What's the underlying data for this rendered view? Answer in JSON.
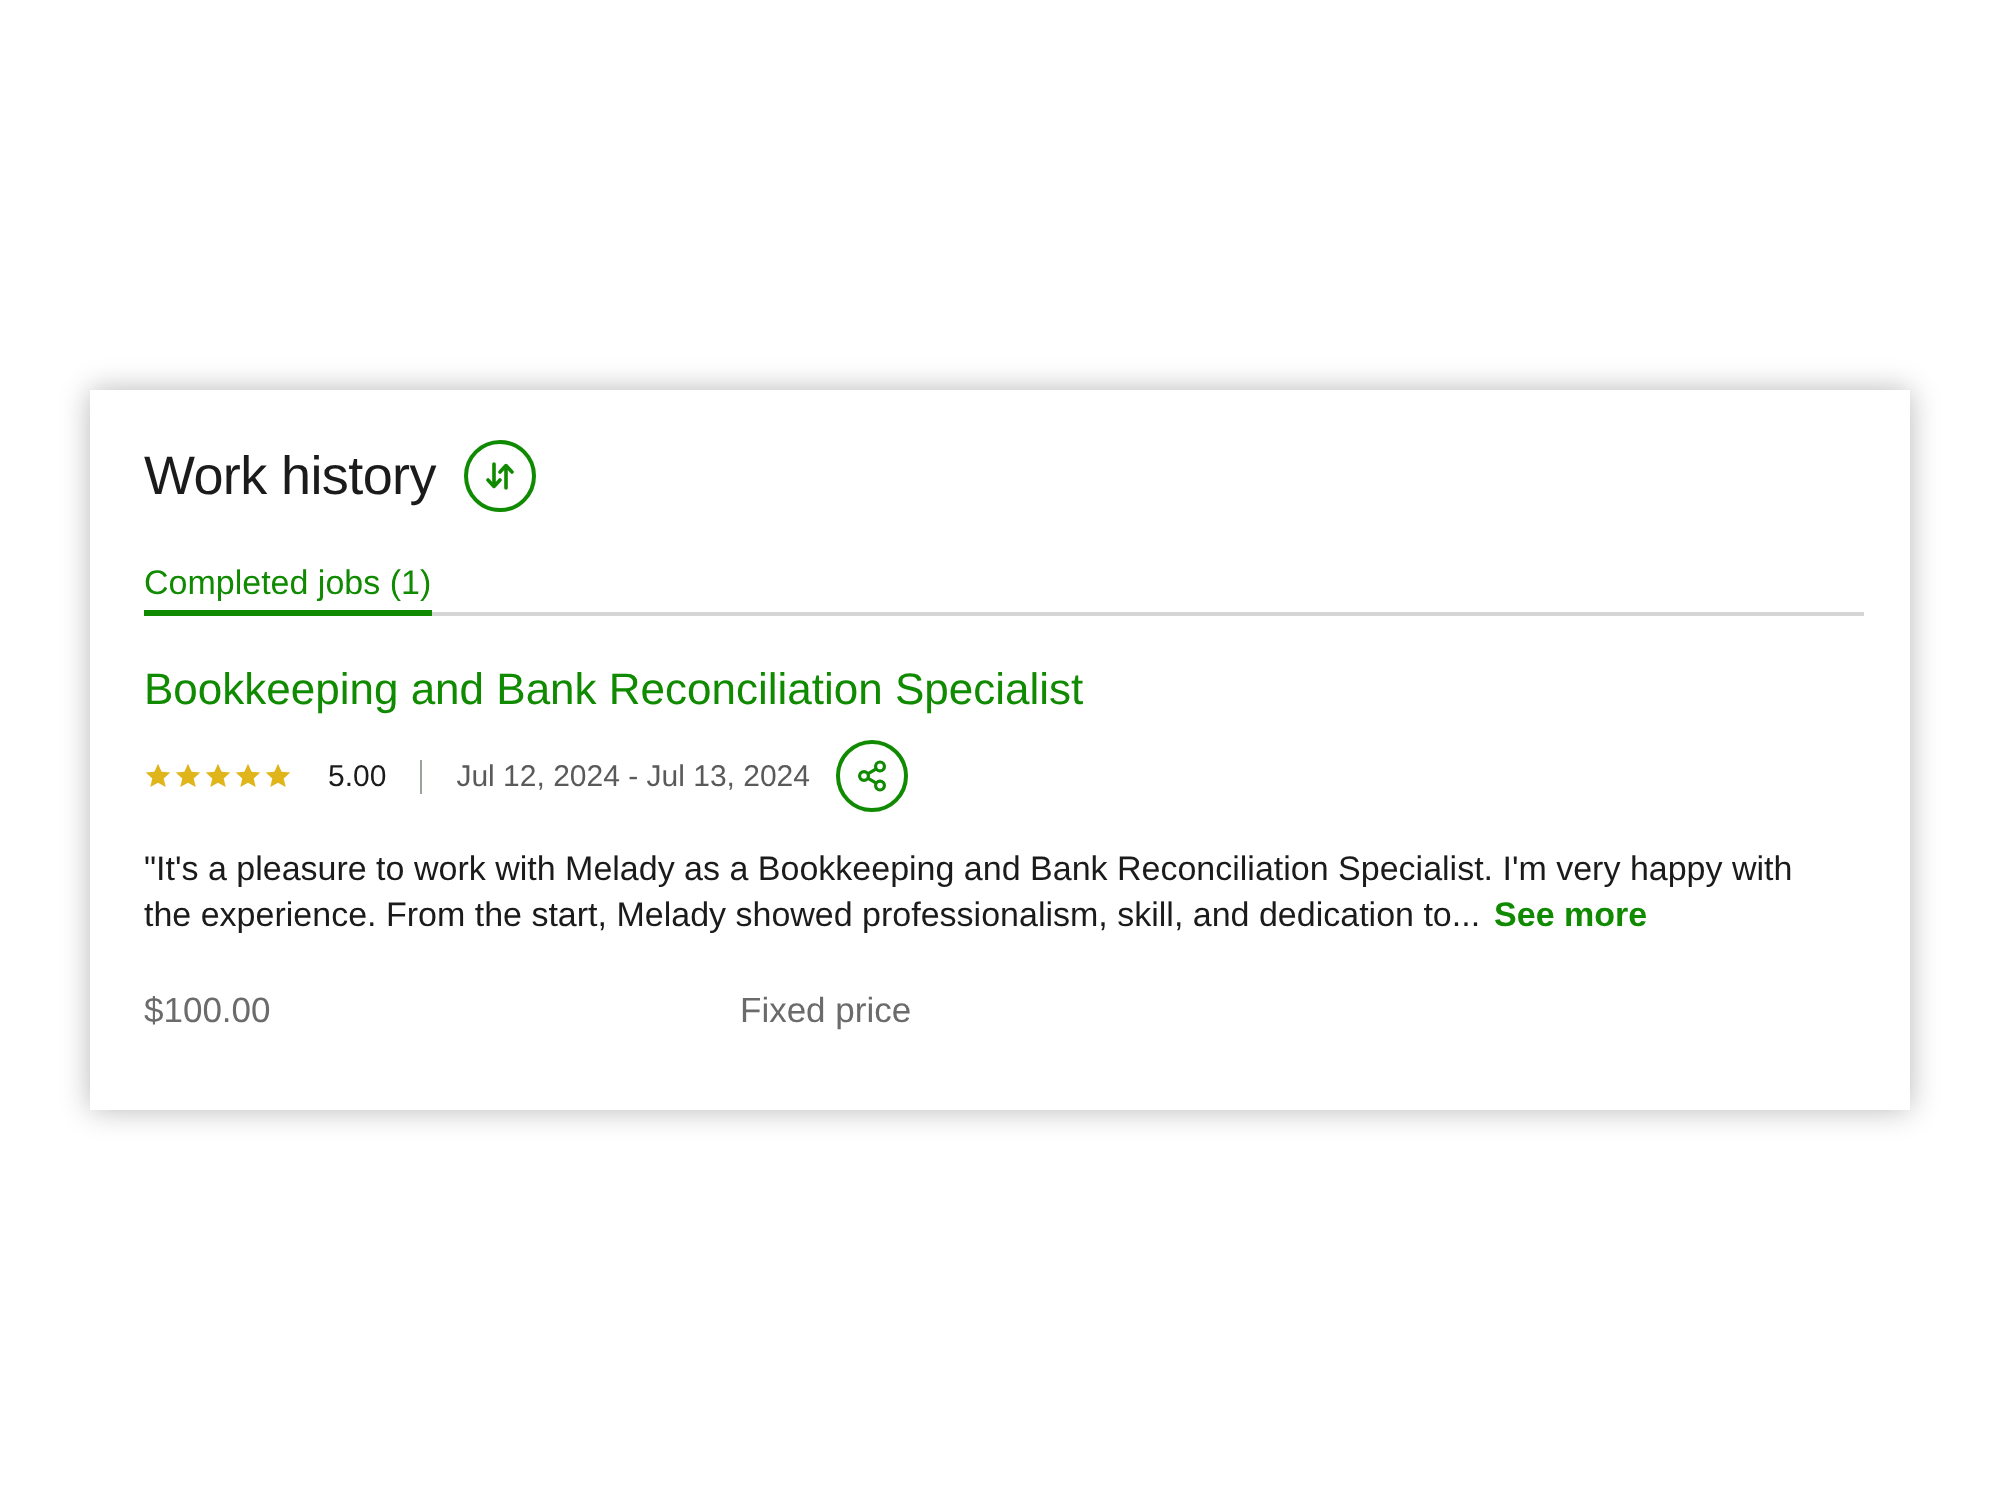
{
  "section": {
    "title": "Work history"
  },
  "tabs": [
    {
      "label": "Completed jobs (1)",
      "selected": true
    }
  ],
  "jobs": [
    {
      "title": "Bookkeeping and Bank Reconciliation Specialist",
      "stars": 5,
      "rating": "5.00",
      "dates": "Jul 12, 2024 - Jul 13, 2024",
      "feedback": "\"It's a pleasure to work with Melady as a Bookkeeping and Bank Reconciliation Specialist. I'm very happy with the experience. From the start, Melady showed professionalism, skill, and dedication to...",
      "more_link": "See more",
      "amount": "$100.00",
      "contract_type": "Fixed price"
    }
  ]
}
